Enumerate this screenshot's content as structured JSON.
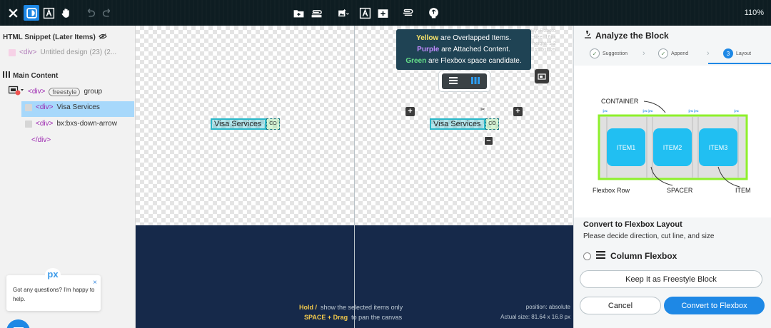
{
  "toolbar": {
    "zoom": "110%",
    "icons": [
      "close-icon",
      "inspector-icon",
      "text-frame-icon",
      "hand-icon",
      "undo-icon",
      "redo-icon",
      "add-folder-icon",
      "attach-icon",
      "add-image-icon",
      "text-frame-icon",
      "add-frame-icon",
      "link-icon",
      "brain-icon"
    ]
  },
  "left_panel": {
    "snippet_title": "HTML Snippet (Later Items)",
    "snippet_item": {
      "tag": "<div>",
      "label": "Untitled design (23) (2..."
    },
    "main_title": "Main Content",
    "tree": {
      "root": {
        "tag": "<div>",
        "badge": "freestyle",
        "label": "group"
      },
      "child1": {
        "tag": "<div>",
        "label": "Visa Services"
      },
      "child2": {
        "tag": "<div>",
        "label": "bx:bxs-down-arrow"
      },
      "close": "</div>"
    },
    "chat": {
      "logo": "px",
      "text": "Got any questions? I'm happy to help.",
      "close": "×"
    }
  },
  "canvas": {
    "legend": {
      "yellow_word": "Yellow",
      "yellow_rest": "are Overlapped Items.",
      "purple_word": "Purple",
      "purple_rest": "are Attached Content.",
      "green_word": "Green",
      "green_rest": "are Flexbox space candidate."
    },
    "element_text": "Visa Services",
    "element_box": "CO",
    "hint1_key": "Hold /",
    "hint1": "show the selected items only",
    "hint2_key": "SPACE + Drag",
    "hint2": "to pan the canvas",
    "position": "position: absolute",
    "actual_size": "Actual size: 81.64 x 16.8 px",
    "ghost_text": [
      "font-family: Roboto",
      "font-size: 16px",
      "line-height: 1.2",
      "color: #1D1D25"
    ]
  },
  "right_panel": {
    "title": "Analyze the Block",
    "steps": [
      {
        "label": "Suggestion",
        "mark": "✓"
      },
      {
        "label": "Append",
        "mark": "✓"
      },
      {
        "label": "Layout",
        "mark": "3"
      }
    ],
    "diagram": {
      "container_label": "CONTAINER",
      "items": [
        "ITEM1",
        "ITEM2",
        "ITEM3"
      ],
      "row_label": "Flexbox Row",
      "spacer_label": "SPACER",
      "item_label": "ITEM"
    },
    "heading": "Convert to Flexbox Layout",
    "subheading": "Please decide direction, cut line, and size",
    "option": "Column Flexbox",
    "keep_button": "Keep It as Freestyle Block",
    "cancel_button": "Cancel",
    "convert_button": "Convert to Flexbox"
  },
  "colors": {
    "accent": "#1e88e5",
    "selection": "#a7d8fb",
    "element": "#2bb8c9",
    "flex_green": "#8ef02b",
    "item_blue": "#21bff2"
  }
}
